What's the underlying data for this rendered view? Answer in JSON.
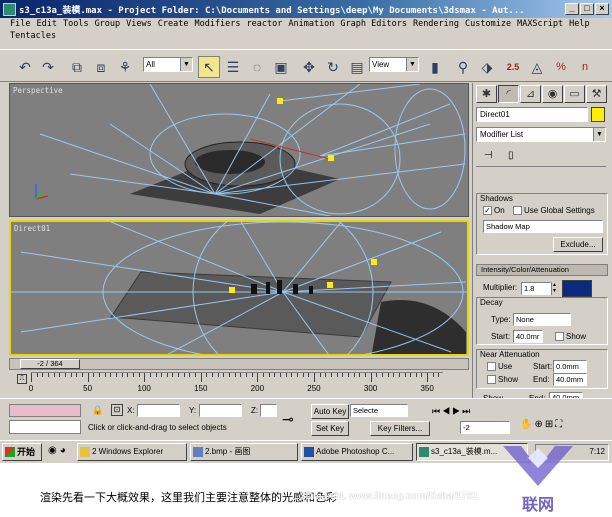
{
  "window": {
    "title": "s3_c13a_装模.max    - Project Folder: C:\\Documents and Settings\\deep\\My Documents\\3dsmax    - Aut..."
  },
  "menus": {
    "row1": [
      "File",
      "Edit",
      "Tools",
      "Group",
      "Views",
      "Create",
      "Modifiers",
      "reactor",
      "Animation",
      "Graph Editors",
      "Rendering",
      "Customize",
      "MAXScript",
      "Help"
    ],
    "row2": [
      "Tentacles"
    ]
  },
  "toolbar": {
    "selection_filter": "All",
    "coord_system": "View",
    "snap_label": "2.5",
    "percent_label": "%",
    "spinner_label": "n"
  },
  "viewports": {
    "top_label": "Perspective",
    "bottom_label": "Direct01"
  },
  "command_panel": {
    "object_name": "Direct01",
    "object_color": "#ffee00",
    "modifier_list": "Modifier List",
    "shadows": {
      "title": "Shadows",
      "on_label": "On",
      "on_checked": true,
      "global_label": "Use Global Settings",
      "global_checked": false,
      "type": "Shadow Map",
      "exclude_label": "Exclude..."
    },
    "intensity": {
      "title": "Intensity/Color/Attenuation",
      "multiplier_label": "Multiplier:",
      "multiplier_value": "1.8",
      "swatch_color": "#0a2a80"
    },
    "decay": {
      "title": "Decay",
      "type_label": "Type:",
      "type_value": "None",
      "start_label": "Start:",
      "start_value": "40.0mr",
      "show_label": "Show"
    },
    "near_atten": {
      "title": "Near Attenuation",
      "use_label": "Use",
      "show_label": "Show",
      "start_label": "Start:",
      "start_value": "0.0mm",
      "end_label": "End:",
      "end_value": "40.0mm"
    },
    "far_partial": {
      "show_label": "Show",
      "end_label": "End:",
      "end_value": "40.0mm"
    }
  },
  "timeline": {
    "frame_display": "-2 / 364",
    "ticks": [
      "0",
      "50",
      "100",
      "150",
      "200",
      "250",
      "300",
      "350"
    ]
  },
  "status": {
    "x_label": "X:",
    "y_label": "Y:",
    "z_label": "Z:",
    "auto_key": "Auto Key",
    "selected": "Selecte",
    "set_key": "Set Key",
    "key_filters": "Key Filters...",
    "prompt": "Click or click-and-drag to select objects",
    "frame_value": "-2"
  },
  "taskbar": {
    "start": "开始",
    "tasks": [
      "2 Windows Explorer",
      "2.bmp - 画图",
      "Adobe Photoshop C...",
      "s3_c13a_装模.m..."
    ],
    "clock": "7:12"
  },
  "caption": "渲染先看一下大概效果，这里我们主要注意整体的光感和色彩",
  "watermark": {
    "url_text": "3DmaxBL  www.lineeg.com/tieba/1761",
    "logo_text": "联网"
  },
  "colors": {
    "titlebar": "#0a246a",
    "viewport_bg": "#7f7f7f",
    "active_border": "#e8d800",
    "light_ray": "#9fd0ff"
  }
}
